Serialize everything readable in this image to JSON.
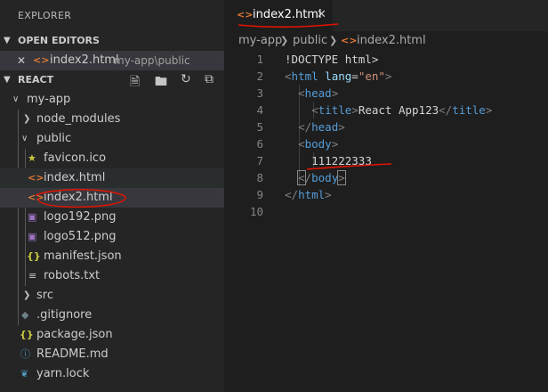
{
  "explorer": {
    "title": "EXPLORER"
  },
  "open_editors": {
    "header": "OPEN EDITORS",
    "items": [
      {
        "name": "index2.html",
        "path": "my-app\\public"
      }
    ]
  },
  "workspace": {
    "header": "REACT",
    "tree": [
      {
        "label": "my-app",
        "type": "folder",
        "expanded": true
      },
      {
        "label": "node_modules",
        "type": "folder",
        "expanded": false
      },
      {
        "label": "public",
        "type": "folder",
        "expanded": true
      },
      {
        "label": "favicon.ico",
        "type": "file",
        "icon": "star-icon"
      },
      {
        "label": "index.html",
        "type": "file",
        "icon": "html-icon"
      },
      {
        "label": "index2.html",
        "type": "file",
        "icon": "html-icon"
      },
      {
        "label": "logo192.png",
        "type": "file",
        "icon": "image-icon"
      },
      {
        "label": "logo512.png",
        "type": "file",
        "icon": "image-icon"
      },
      {
        "label": "manifest.json",
        "type": "file",
        "icon": "json-icon"
      },
      {
        "label": "robots.txt",
        "type": "file",
        "icon": "text-icon"
      },
      {
        "label": "src",
        "type": "folder",
        "expanded": false
      },
      {
        "label": ".gitignore",
        "type": "file",
        "icon": "git-icon"
      },
      {
        "label": "package.json",
        "type": "file",
        "icon": "json-icon"
      },
      {
        "label": "README.md",
        "type": "file",
        "icon": "info-icon"
      },
      {
        "label": "yarn.lock",
        "type": "file",
        "icon": "yarn-icon"
      }
    ]
  },
  "tabs": [
    {
      "label": "index2.html",
      "active": true
    }
  ],
  "breadcrumbs": [
    "my-app",
    "public",
    "index2.html"
  ],
  "editor": {
    "line_numbers": [
      "1",
      "2",
      "3",
      "4",
      "5",
      "6",
      "7",
      "8",
      "9",
      "10"
    ],
    "lines": [
      "<!DOCTYPE html>",
      "<html lang=\"en\">",
      "  <head>",
      "    <title>React App123</title>",
      "  </head>",
      "  <body>",
      "    111222333",
      "  </body>",
      "</html>",
      ""
    ]
  },
  "colors": {
    "sidebar_bg": "#252526",
    "editor_bg": "#1e1e1e",
    "html_icon": "#e37933",
    "tag": "#569cd6",
    "attr": "#9cdcfe",
    "string": "#ce9178",
    "annotation": "#e51400"
  }
}
